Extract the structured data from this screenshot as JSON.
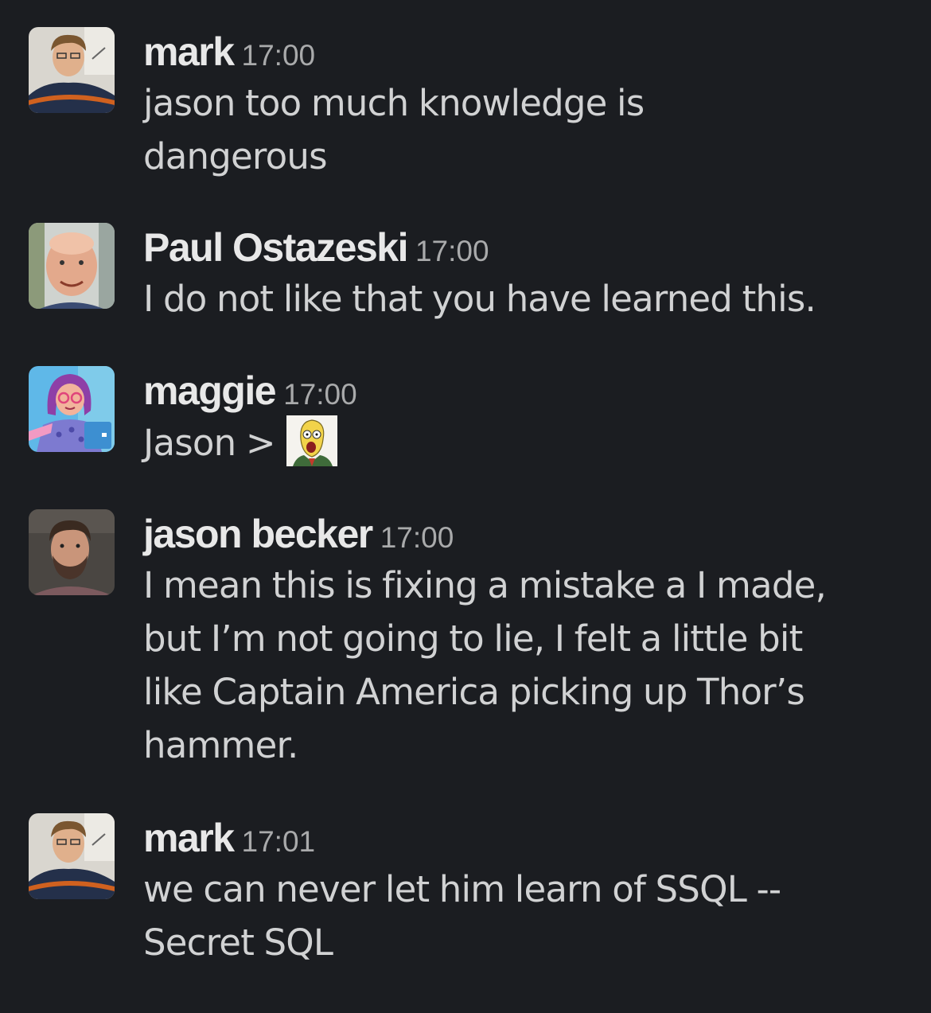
{
  "messages": [
    {
      "sender": "mark",
      "time": "17:00",
      "lines": [
        "jason too much knowledge is",
        "dangerous"
      ],
      "avatar": "mark-avatar"
    },
    {
      "sender": "Paul Ostazeski",
      "time": "17:00",
      "lines": [
        "I do not like that you have learned this."
      ],
      "avatar": "paul-avatar"
    },
    {
      "sender": "maggie",
      "time": "17:00",
      "lines": [
        "Jason >"
      ],
      "avatar": "maggie-avatar",
      "emoji": "mr-burns-emoji"
    },
    {
      "sender": "jason becker",
      "time": "17:00",
      "lines": [
        "I mean this is fixing a mistake a I made,",
        "but I’m not going to lie, I felt a little bit",
        "like Captain America picking up Thor’s",
        "hammer."
      ],
      "avatar": "jason-avatar"
    },
    {
      "sender": "mark",
      "time": "17:01",
      "lines": [
        "we can never let him learn of SSQL --",
        "Secret SQL"
      ],
      "avatar": "mark-avatar"
    }
  ],
  "colors": {
    "background": "#1b1d21",
    "sender": "#e8e8e8",
    "time": "#a9aaab",
    "text": "#d1d2d3"
  }
}
